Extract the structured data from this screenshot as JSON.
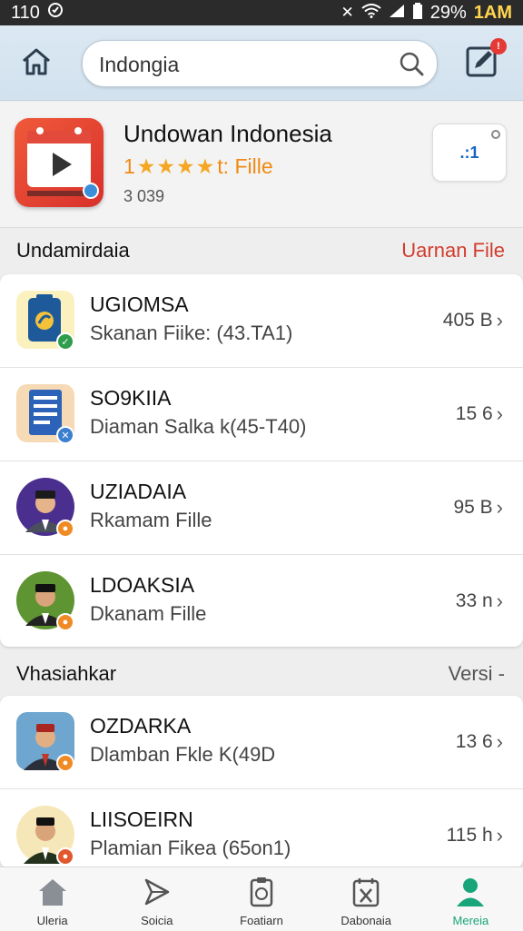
{
  "status_bar": {
    "left_text": "110",
    "battery": "29%",
    "time": "1AM"
  },
  "header": {
    "search_value": "Indongia",
    "notification_badge": "!"
  },
  "featured": {
    "title": "Undowan Indonesia",
    "rating_prefix": "1",
    "rating_stars": "★★★★",
    "rating_text": "t: Fille",
    "size": "3 039",
    "action_label": ".:1"
  },
  "section1": {
    "title": "Undamirdaia",
    "link": "Uarnan File",
    "items": [
      {
        "name": "UGIOMSA",
        "subtitle": "Skanan Fiike: (43.TA1)",
        "size": "405 B",
        "icon": "phone-app-icon"
      },
      {
        "name": "SO9KIIA",
        "subtitle": "Diaman Salka k(45-T40)",
        "size": "15 6",
        "icon": "document-icon"
      },
      {
        "name": "UZIADAIA",
        "subtitle": "Rkamam Fille",
        "size": "95 B",
        "icon": "person-avatar-icon"
      },
      {
        "name": "LDOAKSIA",
        "subtitle": "Dkanam Fille",
        "size": "33 n",
        "icon": "person-avatar-icon"
      }
    ]
  },
  "section2": {
    "title": "Vhasiahkar",
    "link": "Versi -",
    "items": [
      {
        "name": "OZDARKA",
        "subtitle": "Dlamban Fkle K(49D",
        "size": "13 6",
        "icon": "person-avatar-icon"
      },
      {
        "name": "LIISOEIRN",
        "subtitle": "Plamian Fikea (65on1)",
        "size": "115 h",
        "icon": "person-avatar-icon"
      }
    ]
  },
  "bottom_nav": [
    {
      "label": "Uleria",
      "icon": "home-icon"
    },
    {
      "label": "Soicia",
      "icon": "send-icon"
    },
    {
      "label": "Foatiarn",
      "icon": "clipboard-icon"
    },
    {
      "label": "Dabonaia",
      "icon": "calendar-icon"
    },
    {
      "label": "Mereia",
      "icon": "profile-icon"
    }
  ],
  "colors": {
    "accent": "#d23c2e",
    "active_nav": "#18a57a",
    "star": "#f5a623"
  }
}
